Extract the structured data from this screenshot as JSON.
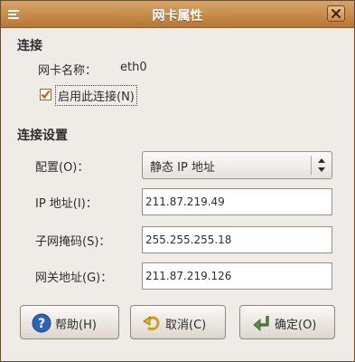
{
  "window": {
    "title": "网卡属性"
  },
  "connection": {
    "header": "连接",
    "name_label": "网卡名称：",
    "name_value": "eth0",
    "enable_label": "启用此连接(N)",
    "enabled": true
  },
  "settings": {
    "header": "连接设置",
    "config_label": "配置(O)：",
    "config_value": "静态 IP 地址",
    "ip_label": "IP 地址(I)：",
    "ip_value": "211.87.219.49",
    "mask_label": "子网掩码(S)：",
    "mask_value": "255.255.255.18",
    "gateway_label": "网关地址(G)：",
    "gateway_value": "211.87.219.126"
  },
  "buttons": {
    "help": "帮助(H)",
    "cancel": "取消(C)",
    "ok": "确定(O)"
  },
  "icons": {
    "window_menu": "window-menu-icon",
    "close": "close-icon",
    "check": "checkmark-icon",
    "help": "help-icon",
    "cancel": "undo-icon",
    "ok": "ok-arrow-icon"
  },
  "colors": {
    "titlebar": "#c68a4c",
    "check": "#d05a0c",
    "help_icon": "#2f63b5"
  }
}
